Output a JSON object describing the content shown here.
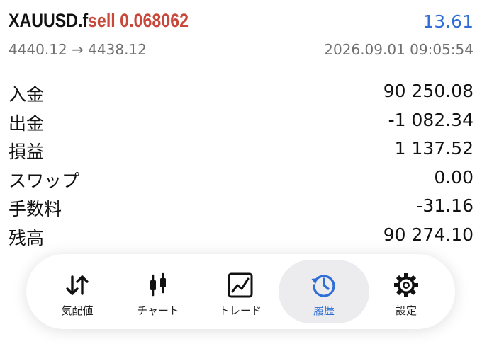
{
  "trade": {
    "symbol": "XAUUSD.f",
    "side_volume": "sell 0.068062",
    "profit": "13.61",
    "price_range": "4440.12 → 4438.12",
    "timestamp": "2026.09.01 09:05:54"
  },
  "summary": [
    {
      "label": "入金",
      "value": "90 250.08"
    },
    {
      "label": "出金",
      "value": "-1 082.34"
    },
    {
      "label": "損益",
      "value": "1 137.52"
    },
    {
      "label": "スワップ",
      "value": "0.00"
    },
    {
      "label": "手数料",
      "value": "-31.16"
    },
    {
      "label": "残高",
      "value": "90 274.10"
    }
  ],
  "tabs": [
    {
      "label": "気配値",
      "icon": "quotes-arrows-icon"
    },
    {
      "label": "チャート",
      "icon": "candlestick-chart-icon"
    },
    {
      "label": "トレード",
      "icon": "trade-chart-icon"
    },
    {
      "label": "履歴",
      "icon": "history-clock-icon",
      "active": true
    },
    {
      "label": "設定",
      "icon": "gear-icon"
    }
  ],
  "colors": {
    "sell": "#c8493b",
    "profit": "#2f6ed6",
    "active_tab": "#2f6ed6",
    "active_tab_bg": "#ececee"
  }
}
